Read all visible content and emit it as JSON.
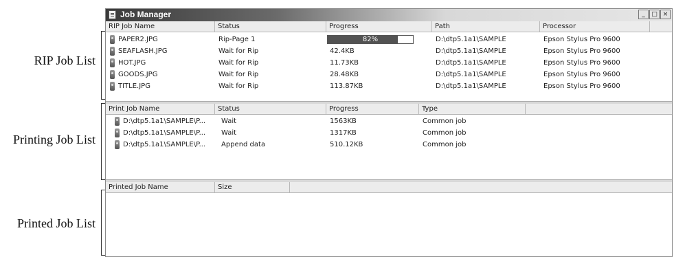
{
  "callouts": {
    "rip": "RIP Job List",
    "printing": "Printing Job List",
    "printed": "Printed Job List"
  },
  "window": {
    "title": "Job Manager",
    "icon": "document-icon",
    "buttons": {
      "minimize": "_",
      "maximize": "□",
      "close": "×"
    }
  },
  "rip_list": {
    "columns": [
      "RIP Job Name",
      "Status",
      "Progress",
      "Path",
      "Processor"
    ],
    "rows": [
      {
        "name": "PAPER2.JPG",
        "status": "Rip-Page 1",
        "progress_text": "82%",
        "progress_fraction": 0.82,
        "path": "D:\\dtp5.1a1\\SAMPLE",
        "processor": "Epson Stylus Pro 9600"
      },
      {
        "name": "SEAFLASH.JPG",
        "status": "Wait for Rip",
        "progress_text": "42.4KB",
        "path": "D:\\dtp5.1a1\\SAMPLE",
        "processor": "Epson Stylus Pro 9600"
      },
      {
        "name": "HOT.JPG",
        "status": "Wait for Rip",
        "progress_text": "11.73KB",
        "path": "D:\\dtp5.1a1\\SAMPLE",
        "processor": "Epson Stylus Pro 9600"
      },
      {
        "name": "GOODS.JPG",
        "status": "Wait for Rip",
        "progress_text": "28.48KB",
        "path": "D:\\dtp5.1a1\\SAMPLE",
        "processor": "Epson Stylus Pro 9600"
      },
      {
        "name": "TITLE.JPG",
        "status": "Wait for Rip",
        "progress_text": "113.87KB",
        "path": "D:\\dtp5.1a1\\SAMPLE",
        "processor": "Epson Stylus Pro 9600"
      }
    ]
  },
  "printing_list": {
    "columns": [
      "Print Job Name",
      "Status",
      "Progress",
      "Type"
    ],
    "rows": [
      {
        "name": "D:\\dtp5.1a1\\SAMPLE\\P...",
        "status": "Wait",
        "progress": "1563KB",
        "type": "Common job"
      },
      {
        "name": "D:\\dtp5.1a1\\SAMPLE\\P...",
        "status": "Wait",
        "progress": "1317KB",
        "type": "Common job"
      },
      {
        "name": "D:\\dtp5.1a1\\SAMPLE\\P...",
        "status": "Append data",
        "progress": "510.12KB",
        "type": "Common job"
      }
    ]
  },
  "printed_list": {
    "columns": [
      "Printed Job Name",
      "Size"
    ]
  }
}
